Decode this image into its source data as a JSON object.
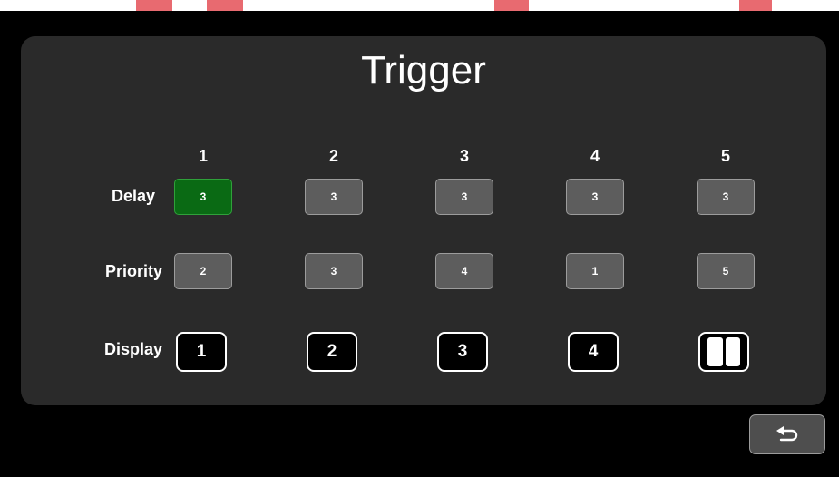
{
  "title": "Trigger",
  "columns": [
    "1",
    "2",
    "3",
    "4",
    "5"
  ],
  "rows": {
    "delay": {
      "label": "Delay",
      "values": [
        "3",
        "3",
        "3",
        "3",
        "3"
      ],
      "selected_index": 0
    },
    "priority": {
      "label": "Priority",
      "values": [
        "2",
        "3",
        "4",
        "1",
        "5"
      ]
    },
    "display": {
      "label": "Display",
      "values": [
        "1",
        "2",
        "3",
        "4"
      ],
      "last_icon": "split-screen-icon"
    }
  },
  "back_icon": "back-arrow-icon",
  "colors": {
    "selected": "#0a6a14",
    "button": "#5d5d5d",
    "panel": "#2a2a2a"
  }
}
